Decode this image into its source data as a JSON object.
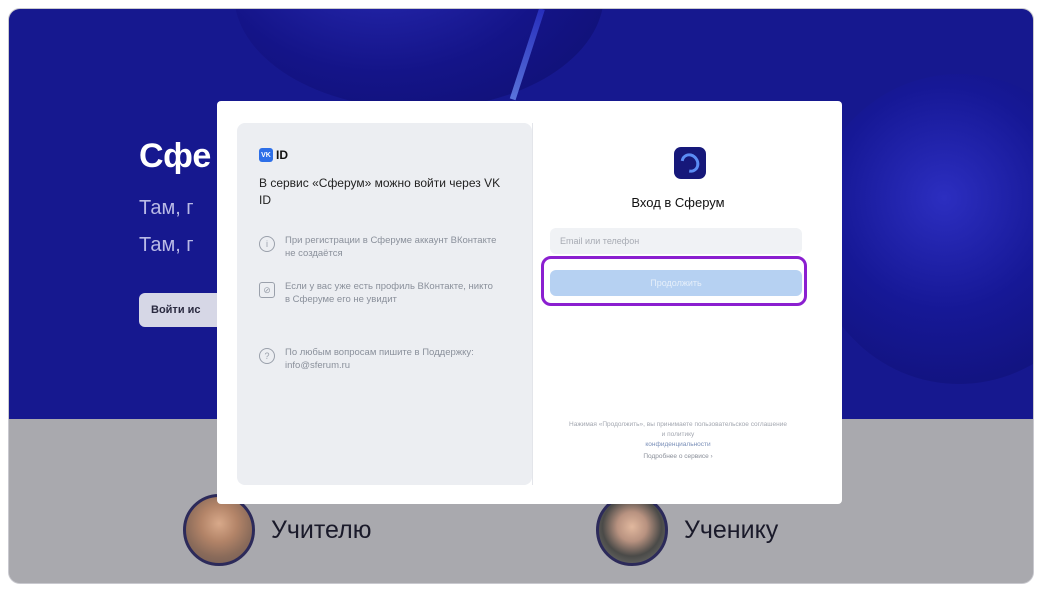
{
  "hero": {
    "title": "Сфе",
    "subtitle_line1": "Там, г",
    "subtitle_line2": "Там, г",
    "button_label": "Войти ис"
  },
  "roles": [
    {
      "label": "Учителю"
    },
    {
      "label": "Ученику"
    }
  ],
  "dialog": {
    "left": {
      "logo_badge": "VK",
      "logo_text": "ID",
      "heading": "В сервис «Сферум» можно войти через VK ID",
      "items": [
        {
          "icon": "info-circle-icon",
          "text": "При регистрации в Сферуме аккаунт ВКонтакте не создаётся"
        },
        {
          "icon": "eye-off-icon",
          "text": "Если у вас уже есть профиль ВКонтакте, никто в Сферуме его не увидит"
        },
        {
          "icon": "help-circle-icon",
          "text": "По любым вопросам пишите в Поддержку: info@sferum.ru"
        }
      ]
    },
    "right": {
      "title": "Вход в Сферум",
      "input_placeholder": "Email или телефон",
      "continue_label": "Продолжить",
      "legal_text": "Нажимая «Продолжить», вы принимаете пользовательское соглашение и политику",
      "legal_link": "конфиденциальности",
      "more_label": "Подробнее о сервисе ›"
    }
  },
  "colors": {
    "hero_bg": "#16188f",
    "highlight": "#8b1fd0",
    "button_disabled": "#b6d1f2",
    "vk_blue": "#2d6fe8"
  }
}
